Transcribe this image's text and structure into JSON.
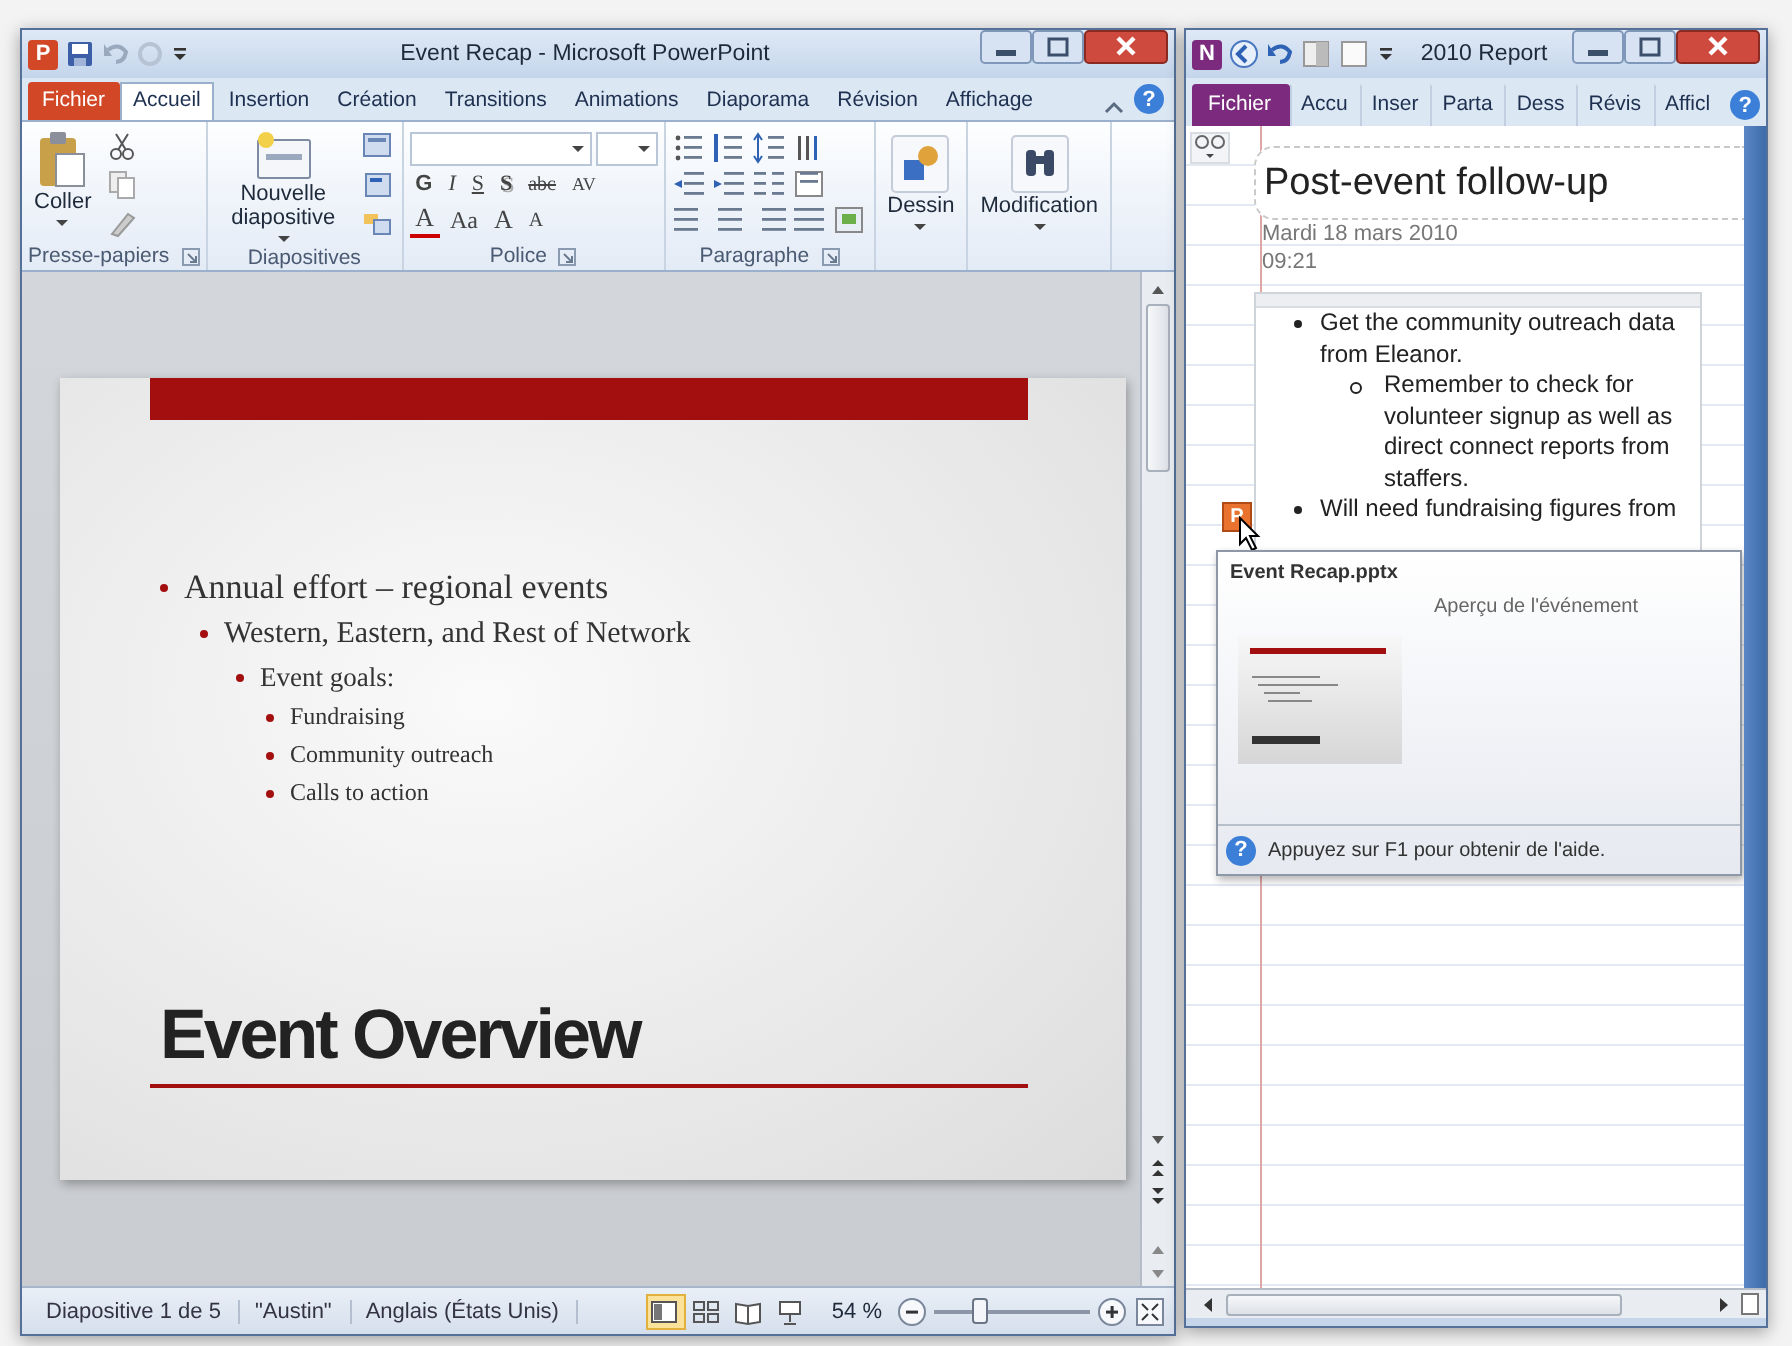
{
  "powerpoint": {
    "app_icon": "P",
    "title": "Event Recap - Microsoft PowerPoint",
    "help": "?",
    "tabs": [
      {
        "label": "Fichier",
        "kind": "file",
        "selected": false
      },
      {
        "label": "Accueil",
        "kind": "tab",
        "selected": true
      },
      {
        "label": "Insertion",
        "kind": "tab",
        "selected": false
      },
      {
        "label": "Création",
        "kind": "tab",
        "selected": false
      },
      {
        "label": "Transitions",
        "kind": "tab",
        "selected": false
      },
      {
        "label": "Animations",
        "kind": "tab",
        "selected": false
      },
      {
        "label": "Diaporama",
        "kind": "tab",
        "selected": false
      },
      {
        "label": "Révision",
        "kind": "tab",
        "selected": false
      },
      {
        "label": "Affichage",
        "kind": "tab",
        "selected": false
      }
    ],
    "ribbon": [
      {
        "kind": "clipboard",
        "label": "Presse-papiers",
        "button": "Coller",
        "launcher": true
      },
      {
        "kind": "slides",
        "label": "Diapositives",
        "button": "Nouvelle diapositive"
      },
      {
        "kind": "font",
        "label": "Police",
        "launcher": true,
        "style_buttons": [
          {
            "text": "G",
            "kind": "bold"
          },
          {
            "text": "I",
            "kind": "italic"
          },
          {
            "text": "S",
            "kind": "underline"
          },
          {
            "text": "S",
            "kind": "shadow"
          },
          {
            "text": "abc",
            "kind": "strike"
          },
          {
            "text": "AV",
            "kind": "spacing"
          }
        ],
        "size_buttons": [
          {
            "text": "A",
            "kind": "color"
          },
          {
            "text": "Aa",
            "kind": "case"
          },
          {
            "text": "A",
            "kind": "grow"
          },
          {
            "text": "A",
            "kind": "shrink"
          }
        ]
      },
      {
        "kind": "paragraph",
        "label": "Paragraphe",
        "launcher": true
      },
      {
        "kind": "drawing",
        "button": "Dessin"
      },
      {
        "kind": "editing",
        "button": "Modification"
      }
    ],
    "slide": {
      "bullets": [
        {
          "text": "Annual effort – regional events",
          "children": [
            {
              "text": "Western, Eastern, and Rest of Network",
              "children": [
                {
                  "text": "Event goals:",
                  "children": [
                    {
                      "text": "Fundraising"
                    },
                    {
                      "text": "Community  outreach"
                    },
                    {
                      "text": "Calls to action"
                    }
                  ]
                }
              ]
            }
          ]
        }
      ],
      "title": "Event Overview"
    },
    "status_bar": {
      "items": [
        "Diapositive 1 de 5",
        "\"Austin\"",
        "Anglais (États Unis)"
      ],
      "views": [
        {
          "kind": "normal",
          "selected": true
        },
        {
          "kind": "sorter",
          "selected": false
        },
        {
          "kind": "reading",
          "selected": false
        },
        {
          "kind": "show",
          "selected": false
        }
      ],
      "zoom": "54 %",
      "zoom_slider": {
        "level": 0.3
      }
    }
  },
  "onenote": {
    "app_icon": "N",
    "title": "2010 Report",
    "help": "?",
    "tabs": [
      {
        "label": "Fichier",
        "kind": "file",
        "selected": false
      },
      {
        "label": "Accu",
        "kind": "tab",
        "selected": false
      },
      {
        "label": "Inser",
        "kind": "tab",
        "selected": false
      },
      {
        "label": "Parta",
        "kind": "tab",
        "selected": false
      },
      {
        "label": "Dess",
        "kind": "tab",
        "selected": false
      },
      {
        "label": "Révis",
        "kind": "tab",
        "selected": false
      },
      {
        "label": "Afficl",
        "kind": "tab",
        "selected": false
      }
    ],
    "page": {
      "title": "Post-event follow-up",
      "date": "Mardi 18 mars 2010",
      "time": "09:21",
      "attachment_icon": "P",
      "notes": [
        {
          "text": "Get the community outreach data from Eleanor.",
          "children": [
            {
              "text": "Remember to check for volunteer signup as well as direct connect reports from staffers."
            }
          ]
        },
        {
          "text": "Will need fundraising figures from"
        }
      ]
    },
    "tooltip": {
      "filename": "Event Recap.pptx",
      "caption": "Aperçu de l'événement",
      "help": "?",
      "hint": "Appuyez sur F1 pour obtenir de l'aide."
    }
  }
}
